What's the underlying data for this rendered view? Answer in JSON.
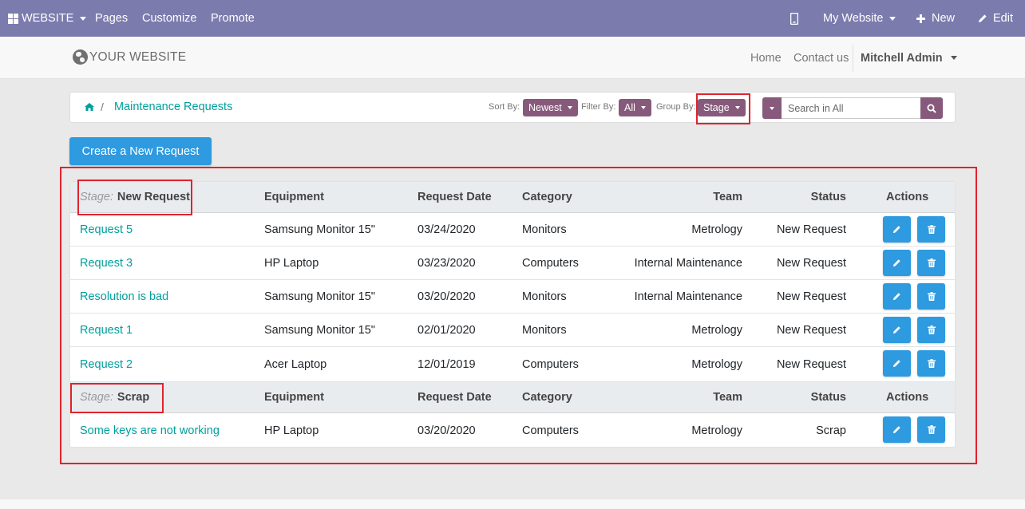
{
  "admin_bar": {
    "website_label": "WEBSITE",
    "pages_label": "Pages",
    "customize_label": "Customize",
    "promote_label": "Promote",
    "my_website_label": "My Website",
    "new_label": "New",
    "edit_label": "Edit"
  },
  "header": {
    "logo_text": "YOUR WEBSITE",
    "nav": [
      "Home",
      "Contact us"
    ],
    "user": "Mitchell Admin"
  },
  "breadcrumb": {
    "current": "Maintenance Requests",
    "separator": "/"
  },
  "controls": {
    "sort_label": "Sort By:",
    "sort_value": "Newest",
    "filter_label": "Filter By:",
    "filter_value": "All",
    "group_label": "Group By:",
    "group_value": "Stage",
    "search_placeholder": "Search in All"
  },
  "create_button": "Create a New Request",
  "table": {
    "columns": [
      "Equipment",
      "Request Date",
      "Category",
      "Team",
      "Status",
      "Actions"
    ],
    "stage_prefix": "Stage:",
    "groups": [
      {
        "stage": "New Request",
        "rows": [
          {
            "name": "Request 5",
            "equipment": "Samsung Monitor 15\"",
            "date": "03/24/2020",
            "category": "Monitors",
            "team": "Metrology",
            "status": "New Request"
          },
          {
            "name": "Request 3",
            "equipment": "HP Laptop",
            "date": "03/23/2020",
            "category": "Computers",
            "team": "Internal Maintenance",
            "status": "New Request"
          },
          {
            "name": "Resolution is bad",
            "equipment": "Samsung Monitor 15\"",
            "date": "03/20/2020",
            "category": "Monitors",
            "team": "Internal Maintenance",
            "status": "New Request"
          },
          {
            "name": "Request 1",
            "equipment": "Samsung Monitor 15\"",
            "date": "02/01/2020",
            "category": "Monitors",
            "team": "Metrology",
            "status": "New Request"
          },
          {
            "name": "Request 2",
            "equipment": "Acer Laptop",
            "date": "12/01/2019",
            "category": "Computers",
            "team": "Metrology",
            "status": "New Request"
          }
        ]
      },
      {
        "stage": "Scrap",
        "rows": [
          {
            "name": "Some keys are not working",
            "equipment": "HP Laptop",
            "date": "03/20/2020",
            "category": "Computers",
            "team": "Metrology",
            "status": "Scrap"
          }
        ]
      }
    ]
  },
  "colors": {
    "admin_bar": "#7c7bad",
    "accent_purple": "#875a7b",
    "teal_link": "#00a09d",
    "primary_blue": "#2e9adf",
    "highlight_red": "#e0232e"
  }
}
